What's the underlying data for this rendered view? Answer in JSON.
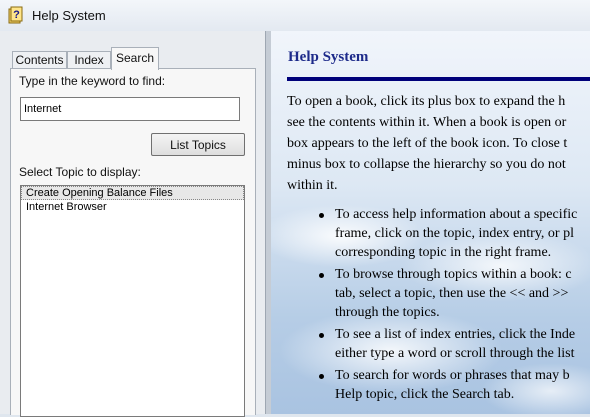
{
  "window": {
    "title": "Help System"
  },
  "tabs": {
    "contents": "Contents",
    "index": "Index",
    "search": "Search"
  },
  "search": {
    "keyword_label": "Type in the keyword to find:",
    "keyword_value": "Internet",
    "list_topics_label": "List Topics",
    "topic_label": "Select Topic to display:",
    "topics": [
      "Create Opening Balance Files",
      "Internet Browser"
    ]
  },
  "content": {
    "heading": "Help System",
    "paragraph_lines": [
      "To open a book, click its plus box to expand the h",
      "see the contents within it. When a book is open or",
      "box appears to the left of the book icon. To close t",
      "minus box to collapse the hierarchy so you do not",
      "within it."
    ],
    "bullets": [
      [
        "To access help information about a specific",
        "frame, click on the topic, index entry, or pl",
        "corresponding topic in the right frame."
      ],
      [
        "To browse through topics within a book: c",
        "tab, select a topic, then use the << and >>",
        "through the topics."
      ],
      [
        "To see a list of index entries, click the Inde",
        "either type a word or scroll through the list"
      ],
      [
        "To search for words or phrases that may b",
        "Help topic, click the Search tab."
      ]
    ]
  },
  "colors": {
    "heading": "#1d2a8a",
    "rule": "#00007a"
  },
  "icons": {
    "app": "help-book-icon"
  }
}
